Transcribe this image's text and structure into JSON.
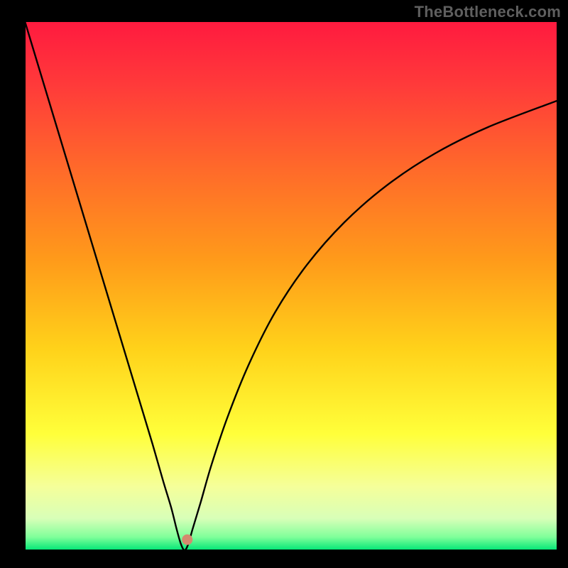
{
  "watermark": "TheBottleneck.com",
  "chart_data": {
    "type": "line",
    "title": "",
    "xlabel": "",
    "ylabel": "",
    "xlim": [
      0,
      100
    ],
    "ylim": [
      0,
      100
    ],
    "background": "rainbow-gradient",
    "gradient_stops": [
      {
        "offset": 0.0,
        "color": "#ff1a3f"
      },
      {
        "offset": 0.12,
        "color": "#ff3a3a"
      },
      {
        "offset": 0.28,
        "color": "#ff6a2a"
      },
      {
        "offset": 0.45,
        "color": "#ff9a1a"
      },
      {
        "offset": 0.62,
        "color": "#ffd21a"
      },
      {
        "offset": 0.78,
        "color": "#ffff3a"
      },
      {
        "offset": 0.88,
        "color": "#f5ff9a"
      },
      {
        "offset": 0.94,
        "color": "#d8ffb8"
      },
      {
        "offset": 0.975,
        "color": "#80ff9a"
      },
      {
        "offset": 1.0,
        "color": "#00e676"
      }
    ],
    "minimum_x": 30,
    "series": [
      {
        "name": "bottleneck-curve",
        "description": "V-shaped bottleneck curve with minimum near x≈30",
        "x": [
          0,
          3,
          6,
          9,
          12,
          15,
          18,
          21,
          24,
          26,
          27.5,
          28.5,
          29.3,
          30,
          30.7,
          31.5,
          33,
          35,
          38,
          42,
          47,
          53,
          60,
          68,
          77,
          87,
          100
        ],
        "y": [
          100,
          90,
          80,
          70,
          60,
          50,
          40,
          30,
          20,
          13,
          8,
          4,
          1.2,
          0,
          1.2,
          4,
          9,
          16,
          25,
          35,
          45,
          54,
          62,
          69,
          75,
          80,
          85
        ]
      }
    ],
    "marker": {
      "x": 30.5,
      "y": 2,
      "r": 1.0,
      "color": "#d48a6e"
    },
    "axes": {
      "border_color": "#000000",
      "plot_inset": {
        "left": 35,
        "right": 15,
        "top": 30,
        "bottom": 25
      }
    }
  }
}
